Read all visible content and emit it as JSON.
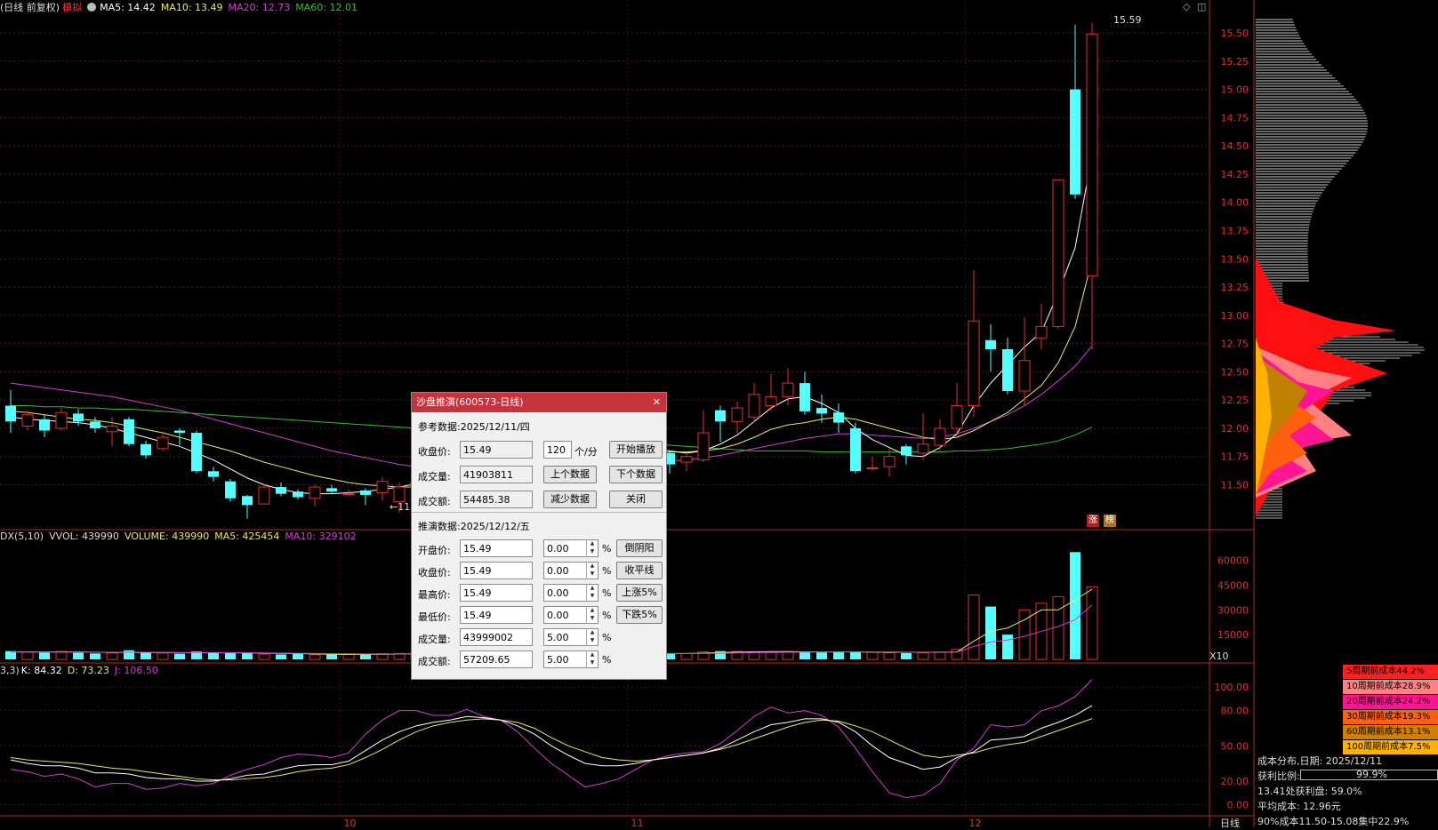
{
  "header": {
    "title": "(日线 前复权)",
    "mode": "模拟",
    "ma5": "MA5: 14.42",
    "ma10": "MA10: 13.49",
    "ma20": "MA20: 12.73",
    "ma60": "MA60: 12.01"
  },
  "price_labels": [
    "15.50",
    "15.25",
    "15.00",
    "14.75",
    "14.50",
    "14.25",
    "14.00",
    "13.75",
    "13.50",
    "13.25",
    "13.00",
    "12.75",
    "12.50",
    "12.25",
    "12.00",
    "11.75",
    "11.50"
  ],
  "high_marker": "15.59",
  "low_marker": "11",
  "badges": {
    "zhang": "涨",
    "bang": "榜"
  },
  "volume_header": {
    "name": "DX(5,10)",
    "vol": "VVOL: 439990",
    "volume": "VOLUME: 439990",
    "ma5": "MA5: 425454",
    "ma10": "MA10: 329102"
  },
  "volume_labels": [
    "60000",
    "45000",
    "30000",
    "15000"
  ],
  "vol_unit": "X10",
  "kdj_header": {
    "name": "3,3)",
    "k": "K: 84.32",
    "d": "D: 73.23",
    "j": "J: 106.50"
  },
  "kdj_labels": [
    "100.00",
    "80.00",
    "50.00",
    "20.00",
    "0.00"
  ],
  "month_labels": [
    "10",
    "11",
    "12"
  ],
  "period_label": "日线",
  "dialog": {
    "title": "沙盘推演(600573-日线)",
    "ref_title": "参考数据:2025/12/11/四",
    "close_label": "收盘价:",
    "close_value": "15.49",
    "speed_value": "120",
    "speed_unit": "个/分",
    "play_button": "开始播放",
    "volume_label": "成交量:",
    "volume_value": "41903811",
    "prev_button": "上个数据",
    "next_button": "下个数据",
    "amount_label": "成交额:",
    "amount_value": "54485.38",
    "reduce_button": "减少数据",
    "close_button": "关闭",
    "sim_title": "推演数据:2025/12/12/五",
    "open_label": "开盘价:",
    "open_value": "15.49",
    "open_pct": "0.00",
    "btn_reverse": "倒阴阳",
    "sclose_label": "收盘价:",
    "sclose_value": "15.49",
    "sclose_pct": "0.00",
    "btn_flat": "收平线",
    "high_label": "最高价:",
    "high_value": "15.49",
    "high_pct": "0.00",
    "btn_up5": "上涨5%",
    "low_label": "最低价:",
    "low_value": "15.49",
    "low_pct": "0.00",
    "btn_down5": "下跌5%",
    "svol_label": "成交量:",
    "svol_value": "43999002",
    "svol_pct": "5.00",
    "samt_label": "成交额:",
    "samt_value": "57209.65",
    "samt_pct": "5.00",
    "pct": "%"
  },
  "cost_legend": [
    {
      "label": "5周期前成本44.2%",
      "color": "#ff2020"
    },
    {
      "label": "10周期前成本28.9%",
      "color": "#ff8080"
    },
    {
      "label": "20周期前成本24.2%",
      "color": "#ff1493"
    },
    {
      "label": "30周期前成本19.3%",
      "color": "#ff6010"
    },
    {
      "label": "60周期前成本13.1%",
      "color": "#d08000"
    },
    {
      "label": "100周期前成本7.5%",
      "color": "#ffb000"
    }
  ],
  "cost_info": {
    "date": "成本分布,日期: 2025/12/11",
    "profit_label": "获利比例:",
    "profit_value": "99.9%",
    "line1": "13.41处获利盘: 59.0%",
    "line2": "平均成本: 12.96元",
    "line3": "90%成本11.50-15.08集中22.9%"
  },
  "colors": {
    "up": "#e03030",
    "down": "#54ffff",
    "ma5": "#ffffff",
    "ma10": "#e8e870",
    "ma20": "#d040d0",
    "ma60": "#30c030",
    "axis_text": "#e03030"
  },
  "chart_data": {
    "type": "candlestick",
    "price_range": [
      11.15,
      15.65
    ],
    "candles": [
      {
        "o": 12.2,
        "c": 12.06,
        "h": 12.34,
        "l": 11.96
      },
      {
        "o": 12.02,
        "c": 12.12,
        "h": 12.16,
        "l": 11.98
      },
      {
        "o": 12.08,
        "c": 11.98,
        "h": 12.12,
        "l": 11.92
      },
      {
        "o": 12.0,
        "c": 12.14,
        "h": 12.18,
        "l": 11.98
      },
      {
        "o": 12.13,
        "c": 12.06,
        "h": 12.17,
        "l": 12.02
      },
      {
        "o": 12.06,
        "c": 12.0,
        "h": 12.1,
        "l": 11.96
      },
      {
        "o": 11.97,
        "c": 12.02,
        "h": 12.1,
        "l": 11.84
      },
      {
        "o": 12.08,
        "c": 11.86,
        "h": 12.1,
        "l": 11.84
      },
      {
        "o": 11.86,
        "c": 11.76,
        "h": 11.89,
        "l": 11.73
      },
      {
        "o": 11.82,
        "c": 11.92,
        "h": 11.95,
        "l": 11.8
      },
      {
        "o": 11.98,
        "c": 11.96,
        "h": 12.0,
        "l": 11.85
      },
      {
        "o": 11.96,
        "c": 11.62,
        "h": 11.98,
        "l": 11.6
      },
      {
        "o": 11.62,
        "c": 11.57,
        "h": 11.66,
        "l": 11.53
      },
      {
        "o": 11.53,
        "c": 11.38,
        "h": 11.55,
        "l": 11.35
      },
      {
        "o": 11.4,
        "c": 11.32,
        "h": 11.41,
        "l": 11.2
      },
      {
        "o": 11.33,
        "c": 11.48,
        "h": 11.5,
        "l": 11.33
      },
      {
        "o": 11.48,
        "c": 11.42,
        "h": 11.52,
        "l": 11.4
      },
      {
        "o": 11.44,
        "c": 11.39,
        "h": 11.46,
        "l": 11.37
      },
      {
        "o": 11.38,
        "c": 11.48,
        "h": 11.5,
        "l": 11.31
      },
      {
        "o": 11.47,
        "c": 11.44,
        "h": 11.5,
        "l": 11.42
      },
      {
        "o": 11.42,
        "c": 11.42,
        "h": 11.46,
        "l": 11.4
      },
      {
        "o": 11.45,
        "c": 11.41,
        "h": 11.47,
        "l": 11.32
      },
      {
        "o": 11.43,
        "c": 11.53,
        "h": 11.57,
        "l": 11.36
      },
      {
        "o": 11.35,
        "c": 11.48,
        "h": 11.52,
        "l": 11.25
      },
      {
        "o": 11.48,
        "c": 11.52,
        "h": 11.58,
        "l": 11.4
      },
      {
        "o": 11.55,
        "c": 11.62,
        "h": 11.66,
        "l": 11.5
      },
      {
        "o": 11.6,
        "c": 11.68,
        "h": 11.72,
        "l": 11.56
      },
      {
        "o": 11.66,
        "c": 11.7,
        "h": 11.74,
        "l": 11.62
      },
      {
        "o": 11.7,
        "c": 11.73,
        "h": 11.77,
        "l": 11.66
      },
      {
        "o": 11.72,
        "c": 11.7,
        "h": 11.76,
        "l": 11.66
      },
      {
        "o": 11.7,
        "c": 11.68,
        "h": 11.74,
        "l": 11.64
      },
      {
        "o": 11.68,
        "c": 11.72,
        "h": 11.76,
        "l": 11.66
      },
      {
        "o": 11.72,
        "c": 11.75,
        "h": 11.79,
        "l": 11.7
      },
      {
        "o": 11.75,
        "c": 11.74,
        "h": 11.8,
        "l": 11.7
      },
      {
        "o": 11.74,
        "c": 11.78,
        "h": 11.82,
        "l": 11.7
      },
      {
        "o": 11.76,
        "c": 11.8,
        "h": 11.84,
        "l": 11.72
      },
      {
        "o": 11.8,
        "c": 11.82,
        "h": 11.86,
        "l": 11.76
      },
      {
        "o": 11.82,
        "c": 11.8,
        "h": 11.88,
        "l": 11.76
      },
      {
        "o": 11.55,
        "c": 11.9,
        "h": 12.0,
        "l": 11.5
      },
      {
        "o": 11.78,
        "c": 11.68,
        "h": 11.8,
        "l": 11.6
      },
      {
        "o": 11.7,
        "c": 11.75,
        "h": 11.78,
        "l": 11.62
      },
      {
        "o": 11.72,
        "c": 11.96,
        "h": 12.16,
        "l": 11.7
      },
      {
        "o": 12.16,
        "c": 12.06,
        "h": 12.2,
        "l": 11.88
      },
      {
        "o": 12.06,
        "c": 12.18,
        "h": 12.24,
        "l": 11.95
      },
      {
        "o": 12.1,
        "c": 12.3,
        "h": 12.4,
        "l": 12.05
      },
      {
        "o": 12.2,
        "c": 12.28,
        "h": 12.48,
        "l": 12.15
      },
      {
        "o": 12.28,
        "c": 12.4,
        "h": 12.53,
        "l": 12.2
      },
      {
        "o": 12.4,
        "c": 12.15,
        "h": 12.5,
        "l": 12.12
      },
      {
        "o": 12.18,
        "c": 12.13,
        "h": 12.3,
        "l": 12.05
      },
      {
        "o": 12.14,
        "c": 12.05,
        "h": 12.22,
        "l": 11.96
      },
      {
        "o": 12.0,
        "c": 11.62,
        "h": 12.05,
        "l": 11.6
      },
      {
        "o": 11.65,
        "c": 11.65,
        "h": 11.75,
        "l": 11.62
      },
      {
        "o": 11.66,
        "c": 11.75,
        "h": 11.82,
        "l": 11.57
      },
      {
        "o": 11.84,
        "c": 11.76,
        "h": 11.86,
        "l": 11.68
      },
      {
        "o": 11.78,
        "c": 11.86,
        "h": 12.13,
        "l": 11.72
      },
      {
        "o": 11.85,
        "c": 12.0,
        "h": 12.08,
        "l": 11.8
      },
      {
        "o": 12.0,
        "c": 12.2,
        "h": 12.4,
        "l": 11.92
      },
      {
        "o": 12.2,
        "c": 12.95,
        "h": 13.4,
        "l": 12.1
      },
      {
        "o": 12.78,
        "c": 12.7,
        "h": 12.92,
        "l": 12.5
      },
      {
        "o": 12.7,
        "c": 12.33,
        "h": 12.8,
        "l": 12.3
      },
      {
        "o": 12.33,
        "c": 12.6,
        "h": 12.98,
        "l": 12.2
      },
      {
        "o": 12.8,
        "c": 12.9,
        "h": 13.1,
        "l": 12.7
      },
      {
        "o": 12.9,
        "c": 14.2,
        "h": 14.2,
        "l": 12.88
      },
      {
        "o": 15.0,
        "c": 14.07,
        "h": 15.57,
        "l": 14.03
      },
      {
        "o": 13.35,
        "c": 15.49,
        "h": 15.59,
        "l": 12.7
      }
    ],
    "ma5": [
      12.1,
      12.08,
      12.07,
      12.06,
      12.05,
      12.03,
      12.0,
      11.96,
      11.92,
      11.88,
      11.84,
      11.78,
      11.72,
      11.64,
      11.56,
      11.5,
      11.46,
      11.43,
      11.42,
      11.42,
      11.43,
      11.44,
      11.46,
      11.48,
      11.51,
      11.55,
      11.6,
      11.64,
      11.68,
      11.7,
      11.71,
      11.72,
      11.73,
      11.74,
      11.76,
      11.78,
      11.79,
      11.81,
      11.83,
      11.8,
      11.78,
      11.8,
      11.86,
      11.94,
      12.06,
      12.18,
      12.26,
      12.28,
      12.22,
      12.14,
      12.0,
      11.9,
      11.83,
      11.76,
      11.75,
      11.83,
      11.95,
      12.2,
      12.4,
      12.56,
      12.72,
      12.85,
      13.2,
      13.6,
      14.42
    ],
    "ma10": [
      12.15,
      12.14,
      12.12,
      12.1,
      12.08,
      12.07,
      12.05,
      12.02,
      11.99,
      11.96,
      11.92,
      11.88,
      11.84,
      11.8,
      11.75,
      11.7,
      11.66,
      11.62,
      11.58,
      11.55,
      11.52,
      11.5,
      11.49,
      11.48,
      11.48,
      11.49,
      11.51,
      11.53,
      11.55,
      11.58,
      11.61,
      11.64,
      11.67,
      11.7,
      11.72,
      11.74,
      11.75,
      11.77,
      11.78,
      11.79,
      11.79,
      11.8,
      11.82,
      11.86,
      11.92,
      11.99,
      12.03,
      12.05,
      12.08,
      12.1,
      12.08,
      12.04,
      12.0,
      11.96,
      11.92,
      11.9,
      11.92,
      11.98,
      12.06,
      12.14,
      12.26,
      12.38,
      12.58,
      12.9,
      13.49
    ],
    "ma20": [
      12.4,
      12.38,
      12.36,
      12.34,
      12.32,
      12.3,
      12.28,
      12.25,
      12.22,
      12.19,
      12.16,
      12.12,
      12.08,
      12.04,
      12.0,
      11.96,
      11.92,
      11.88,
      11.84,
      11.8,
      11.77,
      11.74,
      11.71,
      11.68,
      11.66,
      11.64,
      11.63,
      11.62,
      11.62,
      11.62,
      11.62,
      11.63,
      11.64,
      11.65,
      11.66,
      11.67,
      11.68,
      11.69,
      11.7,
      11.71,
      11.72,
      11.74,
      11.76,
      11.79,
      11.82,
      11.85,
      11.88,
      11.91,
      11.93,
      11.95,
      11.95,
      11.94,
      11.93,
      11.92,
      11.91,
      11.92,
      11.95,
      12.0,
      12.06,
      12.12,
      12.2,
      12.3,
      12.42,
      12.55,
      12.73
    ],
    "ma60": [
      12.2,
      12.2,
      12.19,
      12.19,
      12.18,
      12.18,
      12.17,
      12.17,
      12.16,
      12.15,
      12.14,
      12.13,
      12.12,
      12.11,
      12.1,
      12.09,
      12.08,
      12.07,
      12.06,
      12.05,
      12.04,
      12.03,
      12.02,
      12.01,
      12.0,
      11.99,
      11.98,
      11.97,
      11.96,
      11.95,
      11.94,
      11.93,
      11.92,
      11.91,
      11.9,
      11.89,
      11.88,
      11.87,
      11.86,
      11.85,
      11.84,
      11.83,
      11.82,
      11.81,
      11.8,
      11.8,
      11.8,
      11.8,
      11.79,
      11.79,
      11.79,
      11.79,
      11.79,
      11.79,
      11.79,
      11.79,
      11.8,
      11.8,
      11.81,
      11.82,
      11.84,
      11.86,
      11.89,
      11.94,
      12.01
    ],
    "volume_range": [
      0,
      70000
    ],
    "volumes": [
      5000,
      4500,
      4200,
      4800,
      4000,
      3600,
      3800,
      5500,
      4200,
      3800,
      3500,
      4800,
      4000,
      4200,
      3800,
      3200,
      3000,
      3300,
      2800,
      2900,
      3000,
      3200,
      3500,
      3600,
      3700,
      3500,
      3300,
      3200,
      3000,
      3100,
      3200,
      3000,
      3100,
      3300,
      3400,
      3200,
      3100,
      3300,
      4200,
      3800,
      3600,
      4500,
      5000,
      4800,
      4600,
      4500,
      4700,
      4400,
      4200,
      4500,
      4800,
      4300,
      4100,
      3800,
      4000,
      4500,
      6000,
      39000,
      32000,
      15000,
      30000,
      34000,
      38000,
      65000,
      43999
    ],
    "vol_ma5": [
      4500,
      4500,
      4500,
      4500,
      4500,
      4400,
      4200,
      4200,
      4100,
      4200,
      4100,
      4000,
      4000,
      4000,
      3900,
      3800,
      3600,
      3500,
      3300,
      3100,
      3000,
      3000,
      3100,
      3200,
      3400,
      3500,
      3500,
      3500,
      3400,
      3300,
      3200,
      3100,
      3100,
      3100,
      3200,
      3200,
      3200,
      3300,
      3500,
      3500,
      3600,
      3800,
      4200,
      4400,
      4600,
      4700,
      4700,
      4600,
      4500,
      4500,
      4500,
      4400,
      4300,
      4300,
      4300,
      4300,
      4500,
      11000,
      17000,
      19000,
      24000,
      30000,
      30000,
      36000,
      42545
    ],
    "vol_ma10": [
      4400,
      4400,
      4400,
      4400,
      4400,
      4400,
      4300,
      4300,
      4300,
      4200,
      4100,
      4100,
      4100,
      4000,
      4000,
      3900,
      3800,
      3700,
      3600,
      3500,
      3400,
      3300,
      3300,
      3300,
      3300,
      3300,
      3300,
      3300,
      3300,
      3300,
      3300,
      3300,
      3300,
      3300,
      3300,
      3300,
      3300,
      3300,
      3400,
      3400,
      3500,
      3600,
      3700,
      3900,
      4100,
      4200,
      4300,
      4400,
      4500,
      4500,
      4500,
      4500,
      4500,
      4400,
      4400,
      4400,
      4400,
      7800,
      10500,
      11700,
      14000,
      17000,
      20000,
      24000,
      32910
    ],
    "kdj_range": [
      -5,
      110
    ],
    "k": [
      38,
      35,
      33,
      33,
      31,
      27,
      27,
      26,
      23,
      22,
      22,
      20,
      20,
      22,
      25,
      26,
      30,
      33,
      34,
      34,
      37,
      46,
      55,
      62,
      67,
      70,
      72,
      75,
      74,
      72,
      67,
      60,
      50,
      42,
      35,
      33,
      33,
      35,
      38,
      40,
      42,
      44,
      48,
      55,
      62,
      68,
      70,
      73,
      73,
      70,
      62,
      50,
      40,
      35,
      30,
      32,
      40,
      45,
      55,
      56,
      58,
      65,
      70,
      76,
      84.32
    ],
    "d": [
      40,
      38,
      37,
      36,
      35,
      33,
      31,
      30,
      28,
      26,
      24,
      22,
      21,
      21,
      22,
      23,
      25,
      28,
      30,
      31,
      34,
      40,
      47,
      55,
      62,
      67,
      70,
      72,
      73,
      72,
      70,
      65,
      57,
      50,
      45,
      40,
      38,
      37,
      38,
      40,
      42,
      44,
      47,
      51,
      56,
      61,
      66,
      70,
      72,
      71,
      67,
      62,
      55,
      48,
      42,
      40,
      42,
      44,
      48,
      51,
      53,
      58,
      63,
      68,
      73.23
    ],
    "j": [
      30,
      28,
      24,
      26,
      22,
      15,
      18,
      18,
      13,
      14,
      18,
      16,
      18,
      25,
      30,
      34,
      40,
      43,
      42,
      40,
      44,
      60,
      72,
      80,
      80,
      76,
      76,
      81,
      75,
      72,
      62,
      48,
      35,
      25,
      15,
      18,
      22,
      30,
      38,
      42,
      44,
      45,
      52,
      63,
      75,
      83,
      78,
      80,
      76,
      66,
      48,
      28,
      10,
      6,
      8,
      18,
      38,
      48,
      68,
      66,
      68,
      80,
      84,
      92,
      106.5
    ]
  }
}
